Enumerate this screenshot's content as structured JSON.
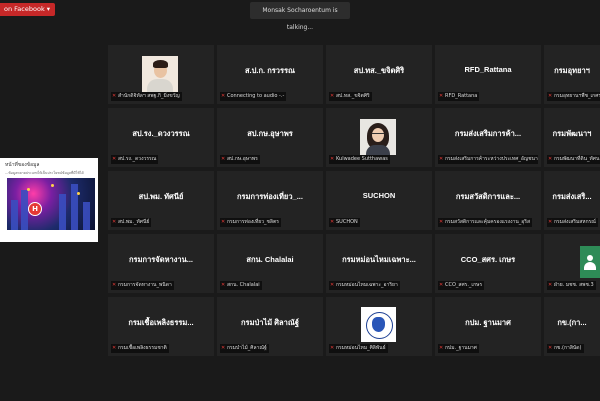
{
  "facebook_badge": "on Facebook ▾",
  "talking_indicator": "Monsak Socharoentum is talking...",
  "share": {
    "title": "หน้าที่ของข้อมูล",
    "subtitle": "...ข้อมูลหลายประเภทให้เป็นประโยชน์ข้อมูลที่มีใช้ได้"
  },
  "tiles": [
    {
      "name": "",
      "label": "สำนักดิจิทัลฯ สพฐ.กิ_มิ่งขวัญ",
      "avatar": "man"
    },
    {
      "name": "ส.ป.ก. กรวรรณ",
      "label": "Connecting to audio -.-"
    },
    {
      "name": "สป.ทส._ขจิตศิริ",
      "label": "สป.ทส._ขจิตศิริ"
    },
    {
      "name": "RFD_Rattana",
      "label": "RFD_Rattana"
    },
    {
      "name": "กรมอุทยาฯ",
      "label": "กรมอุทยานฯพืช_เกศร"
    },
    {
      "name": "สป.รง._ดวงวรรณ",
      "label": "สป.รง._ดวงวรรณ"
    },
    {
      "name": "สป.กษ.อุษาพร",
      "label": "สป.กษ.อุษาพร"
    },
    {
      "name": "",
      "label": "Kulwadee Sutthawas",
      "avatar": "woman"
    },
    {
      "name": "กรมส่งเสริมการค้า...",
      "label": "กรมส่งเสริมการค้าระหว่างประเทศ_อัญชนาฯ"
    },
    {
      "name": "กรมพัฒนาฯ",
      "label": "กรมพัฒนาที่ดิน_ทัศน"
    },
    {
      "name": "สป.พม. ทัศนีย์",
      "label": "สป.พม._ทัศนีย์"
    },
    {
      "name": "กรมการท่องเที่ยว_...",
      "label": "กรมการท่องเที่ยว_ชลิตร"
    },
    {
      "name": "SUCHON",
      "label": "SUCHON"
    },
    {
      "name": "กรมสวัสดิการและ...",
      "label": "กรมสวัสดิการและคุ้มครองแรงงาน_อุริส"
    },
    {
      "name": "กรมส่งเสริ...",
      "label": "กรมส่งเสริมสหกรณ์"
    },
    {
      "name": "กรมการจัดหางาน...",
      "label": "กรมการจัดหางาน_พนิดา"
    },
    {
      "name": "สกน. Chalalai",
      "label": "สกน. Chalalai"
    },
    {
      "name": "กรมหม่อนไหมเฉพาะ...",
      "label": "กรมหม่อนไหมเฉพาะ_อาริยา"
    },
    {
      "name": "CCO_สศร. เกษร",
      "label": "CCO_สศร._เกษร"
    },
    {
      "name": "",
      "label": "ฝ่าย. มชช. สพช.3",
      "avatar": "green"
    },
    {
      "name": "กรมเชื้อเพลิงธรรม...",
      "label": "กรมเชื้อเพลิงธรรมชาติ"
    },
    {
      "name": "กรมป่าไม้ ศิลาณัฐ์",
      "label": "กรมป่าไม้_ศิลาณัฐ์"
    },
    {
      "name": "",
      "label": "กรมหม่อนไหม_ศิลิพันธ์",
      "avatar": "seal"
    },
    {
      "name": "กปม. ฐานมาศ",
      "label": "กปม._ฐานมาศ"
    },
    {
      "name": "กข.(กา...",
      "label": "กข.(กาสินัด)"
    }
  ]
}
